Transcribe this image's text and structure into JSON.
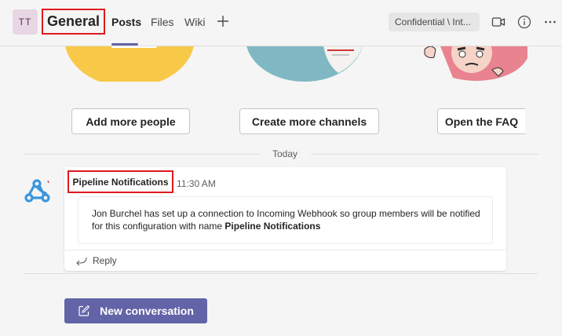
{
  "header": {
    "team_avatar": "TT",
    "channel_name": "General",
    "tabs": [
      {
        "label": "Posts",
        "active": true
      },
      {
        "label": "Files",
        "active": false
      },
      {
        "label": "Wiki",
        "active": false
      }
    ],
    "add_tab_icon": "plus-icon",
    "sensitivity_label": "Confidential \\ Int...",
    "icons": [
      "video-camera-icon",
      "info-icon",
      "more-options-icon"
    ]
  },
  "welcome": {
    "cards": [
      {
        "label": "Add more people"
      },
      {
        "label": "Create more channels"
      },
      {
        "label": "Open the FAQ"
      }
    ]
  },
  "feed": {
    "day_label": "Today",
    "messages": [
      {
        "sender": "Pipeline Notifications",
        "time": "11:30 AM",
        "avatar_icon": "webhook-icon",
        "body_text": "Jon Burchel has set up a connection to Incoming Webhook so group members will be notified for this configuration with name ",
        "body_bold": "Pipeline Notifications",
        "reply_label": "Reply"
      }
    ]
  },
  "compose": {
    "new_conversation_label": "New conversation",
    "icon": "compose-icon"
  },
  "colors": {
    "accent": "#6264a7",
    "highlight_box": "#e0191c",
    "background": "#f5f5f5"
  }
}
